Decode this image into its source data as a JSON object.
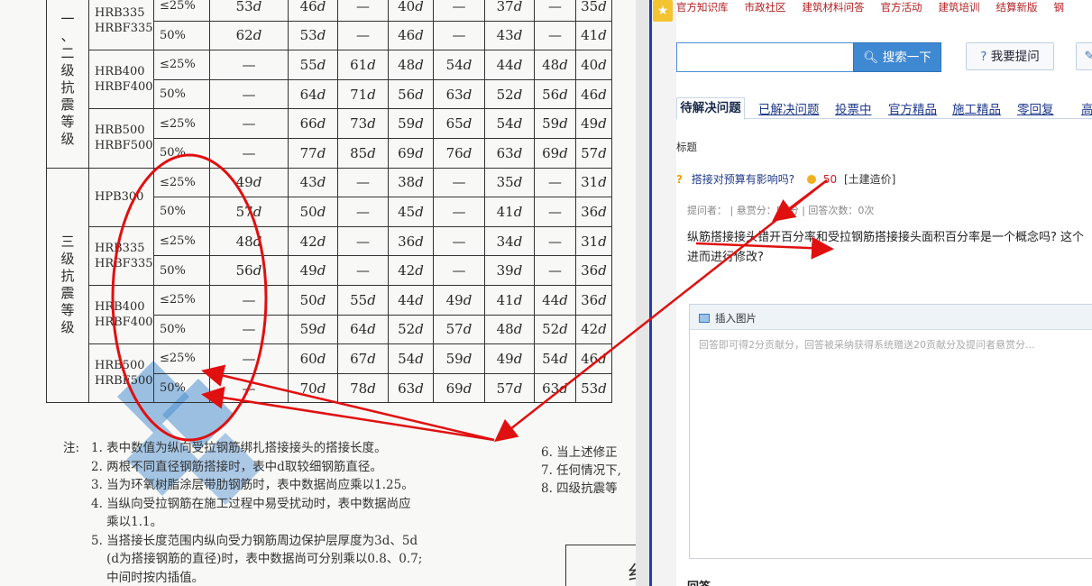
{
  "document": {
    "groups": [
      {
        "label": "二级抗震等级",
        "label_visible": "一、二级抗震等级"
      },
      {
        "label": "三级抗震等级"
      }
    ],
    "table": {
      "rows": [
        {
          "grade": [
            "HRB335",
            "HRBF335"
          ],
          "pct": "≤25%",
          "cells": [
            "53d",
            "46d",
            "—",
            "40d",
            "—",
            "37d",
            "—",
            "35d"
          ]
        },
        {
          "pct": "50%",
          "cells": [
            "62d",
            "53d",
            "—",
            "46d",
            "—",
            "43d",
            "—",
            "41d"
          ]
        },
        {
          "grade": [
            "HRB400",
            "HRBF400"
          ],
          "pct": "≤25%",
          "cells": [
            "—",
            "55d",
            "61d",
            "48d",
            "54d",
            "44d",
            "48d",
            "40d"
          ]
        },
        {
          "pct": "50%",
          "cells": [
            "—",
            "64d",
            "71d",
            "56d",
            "63d",
            "52d",
            "56d",
            "46d"
          ]
        },
        {
          "grade": [
            "HRB500",
            "HRBF500"
          ],
          "pct": "≤25%",
          "cells": [
            "—",
            "66d",
            "73d",
            "59d",
            "65d",
            "54d",
            "59d",
            "49d"
          ]
        },
        {
          "pct": "50%",
          "cells": [
            "—",
            "77d",
            "85d",
            "69d",
            "76d",
            "63d",
            "69d",
            "57d"
          ]
        },
        {
          "grade": [
            "HPB300"
          ],
          "pct": "≤25%",
          "cells": [
            "49d",
            "43d",
            "—",
            "38d",
            "—",
            "35d",
            "—",
            "31d"
          ]
        },
        {
          "pct": "50%",
          "cells": [
            "57d",
            "50d",
            "—",
            "45d",
            "—",
            "41d",
            "—",
            "36d"
          ]
        },
        {
          "grade": [
            "HRB335",
            "HRBF335"
          ],
          "pct": "≤25%",
          "cells": [
            "48d",
            "42d",
            "—",
            "36d",
            "—",
            "34d",
            "—",
            "31d"
          ]
        },
        {
          "pct": "50%",
          "cells": [
            "56d",
            "49d",
            "—",
            "42d",
            "—",
            "39d",
            "—",
            "36d"
          ]
        },
        {
          "grade": [
            "HRB400",
            "HRBF400"
          ],
          "pct": "≤25%",
          "cells": [
            "—",
            "50d",
            "55d",
            "44d",
            "49d",
            "41d",
            "44d",
            "36d"
          ]
        },
        {
          "pct": "50%",
          "cells": [
            "—",
            "59d",
            "64d",
            "52d",
            "57d",
            "48d",
            "52d",
            "42d"
          ]
        },
        {
          "grade": [
            "HRB500",
            "HRBF500"
          ],
          "pct": "≤25%",
          "cells": [
            "—",
            "60d",
            "67d",
            "54d",
            "59d",
            "49d",
            "54d",
            "46d"
          ]
        },
        {
          "pct": "50%",
          "cells": [
            "—",
            "70d",
            "78d",
            "63d",
            "69d",
            "57d",
            "63d",
            "53d"
          ]
        }
      ]
    },
    "notes_prefix": "注:",
    "notes": [
      "1. 表中数值为纵向受拉钢筋绑扎搭接接头的搭接长度。",
      "2. 两根不同直径钢筋搭接时，表中d取较细钢筋直径。",
      "3. 当为环氧树脂涂层带肋钢筋时，表中数据尚应乘以1.25。",
      "4. 当纵向受拉钢筋在施工过程中易受扰动时，表中数据尚应",
      "    乘以1.1。",
      "5. 当搭接长度范围内纵向受力钢筋周边保护层厚度为3d、5d",
      "    (d为搭接钢筋的直径)时，表中数据尚可分别乘以0.8、0.7;",
      "    中间时按内插值。"
    ],
    "notes_right": [
      "6. 当上述修正",
      "7. 任何情况下,",
      "8. 四级抗震等"
    ],
    "box_char": "纟"
  },
  "web": {
    "top_nav": [
      "官方知识库",
      "市政社区",
      "建筑材料问答",
      "官方活动",
      "建筑培训",
      "结算新版",
      "钢"
    ],
    "search": {
      "placeholder": "",
      "button_label": "搜索一下"
    },
    "ask_button_label": "我要提问",
    "tabs": [
      "待解决问题",
      "已解决问题",
      "投票中",
      "官方精品",
      "施工精品",
      "零回复",
      "高悬"
    ],
    "tabs_visible_first": "待解决问题",
    "section_label": "标题",
    "question": {
      "title": "搭接对预算有影响吗?",
      "score": "50",
      "category": "[土建造价]",
      "meta": "提问者：  |  悬赏分：50分  |  回答次数：0次",
      "body": "纵筋搭接接头错开百分率和受拉钢筋搭接接头面积百分率是一个概念吗? 这个进而进行修改?"
    },
    "editor": {
      "insert_image_label": "插入图片",
      "placeholder": "回答即可得2分贡献分，回答被采纳获得系统赠送20贡献分及提问者悬赏分..."
    },
    "answers_label": "回答"
  },
  "colors": {
    "annotation": "#e01010",
    "accent_blue": "#3f89d3",
    "nav_red": "#b02020",
    "divider_blue": "#1f3fb0"
  }
}
